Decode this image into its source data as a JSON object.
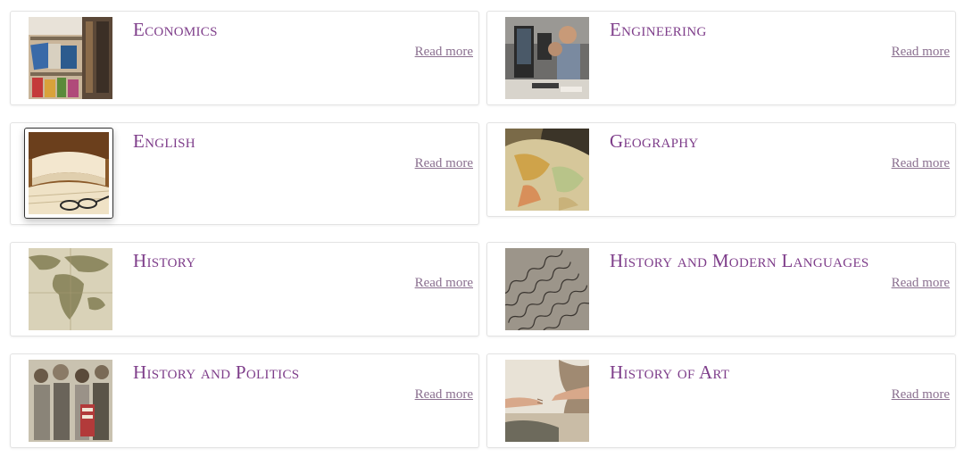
{
  "read_more_label": "Read more",
  "subjects": [
    {
      "title": "Economics",
      "image": "library-bookshelf-photo"
    },
    {
      "title": "Engineering",
      "image": "students-at-computers-photo"
    },
    {
      "title": "English",
      "image": "open-book-with-glasses-photo"
    },
    {
      "title": "Geography",
      "image": "antique-globe-map-photo"
    },
    {
      "title": "History",
      "image": "old-world-map-photo"
    },
    {
      "title": "History and Modern Languages",
      "image": "handwritten-manuscript-photo"
    },
    {
      "title": "History and Politics",
      "image": "suffragette-crowd-illustration"
    },
    {
      "title": "History of Art",
      "image": "creation-of-adam-fresco-photo"
    }
  ]
}
